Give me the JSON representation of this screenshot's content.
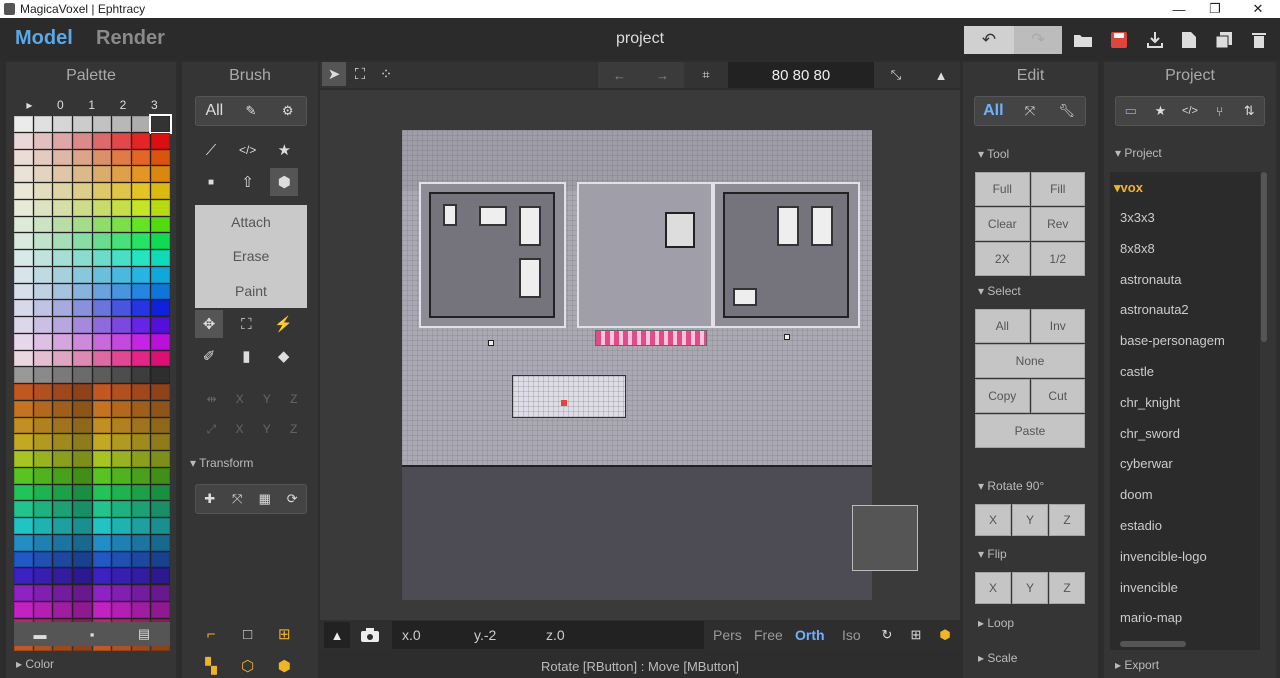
{
  "window": {
    "title": "MagicaVoxel | Ephtracy",
    "min": "—",
    "max": "❐",
    "close": "✕"
  },
  "top": {
    "model": "Model",
    "render": "Render",
    "project": "project",
    "undo": "↶",
    "redo": "↷",
    "open": "▆",
    "save": "▆",
    "import": "⭳",
    "new": "▤",
    "copy": "❐",
    "delete": "▮"
  },
  "palette": {
    "title": "Palette",
    "tabs": [
      "▸",
      "0",
      "1",
      "2",
      "3"
    ],
    "color_label": "▸ Color",
    "bottom": [
      "▬",
      "▪",
      "▤"
    ]
  },
  "brush": {
    "title": "Brush",
    "all": "All",
    "modes": [
      "Attach",
      "Erase",
      "Paint"
    ],
    "mirror": [
      "X",
      "Y",
      "Z"
    ],
    "axis": [
      "X",
      "Y",
      "Z"
    ],
    "transform": "▾ Transform"
  },
  "viewport": {
    "dims": "80 80 80",
    "coords": {
      "x": "x.0",
      "y": "y.-2",
      "z": "z.0"
    },
    "views": [
      "Pers",
      "Free",
      "Orth",
      "Iso"
    ],
    "active_view": "Orth",
    "status": "Rotate [RButton] : Move [MButton]"
  },
  "edit": {
    "title": "Edit",
    "all": "All",
    "tool": "▾ Tool",
    "tool_buttons": [
      "Full",
      "Fill",
      "Clear",
      "Rev",
      "2X",
      "1/2"
    ],
    "select": "▾ Select",
    "select_buttons": [
      "All",
      "Inv",
      "None",
      "Copy",
      "Cut",
      "Paste"
    ],
    "rotate": "▾ Rotate 90°",
    "rotate_buttons": [
      "X",
      "Y",
      "Z"
    ],
    "flip": "▾ Flip",
    "flip_buttons": [
      "X",
      "Y",
      "Z"
    ],
    "loop": "▸ Loop",
    "scale": "▸ Scale"
  },
  "project": {
    "title": "Project",
    "section": "▾ Project",
    "folder": "▾vox",
    "items": [
      "3x3x3",
      "8x8x8",
      "astronauta",
      "astronauta2",
      "base-personagem",
      "castle",
      "chr_knight",
      "chr_sword",
      "cyberwar",
      "doom",
      "estadio",
      "invencible-logo",
      "invencible",
      "mario-map"
    ],
    "export": "▸ Export"
  },
  "colors": {
    "accent": "#5aa8e8",
    "folder": "#f0b429",
    "save": "#e0443a",
    "active": "#6fb0ff"
  }
}
